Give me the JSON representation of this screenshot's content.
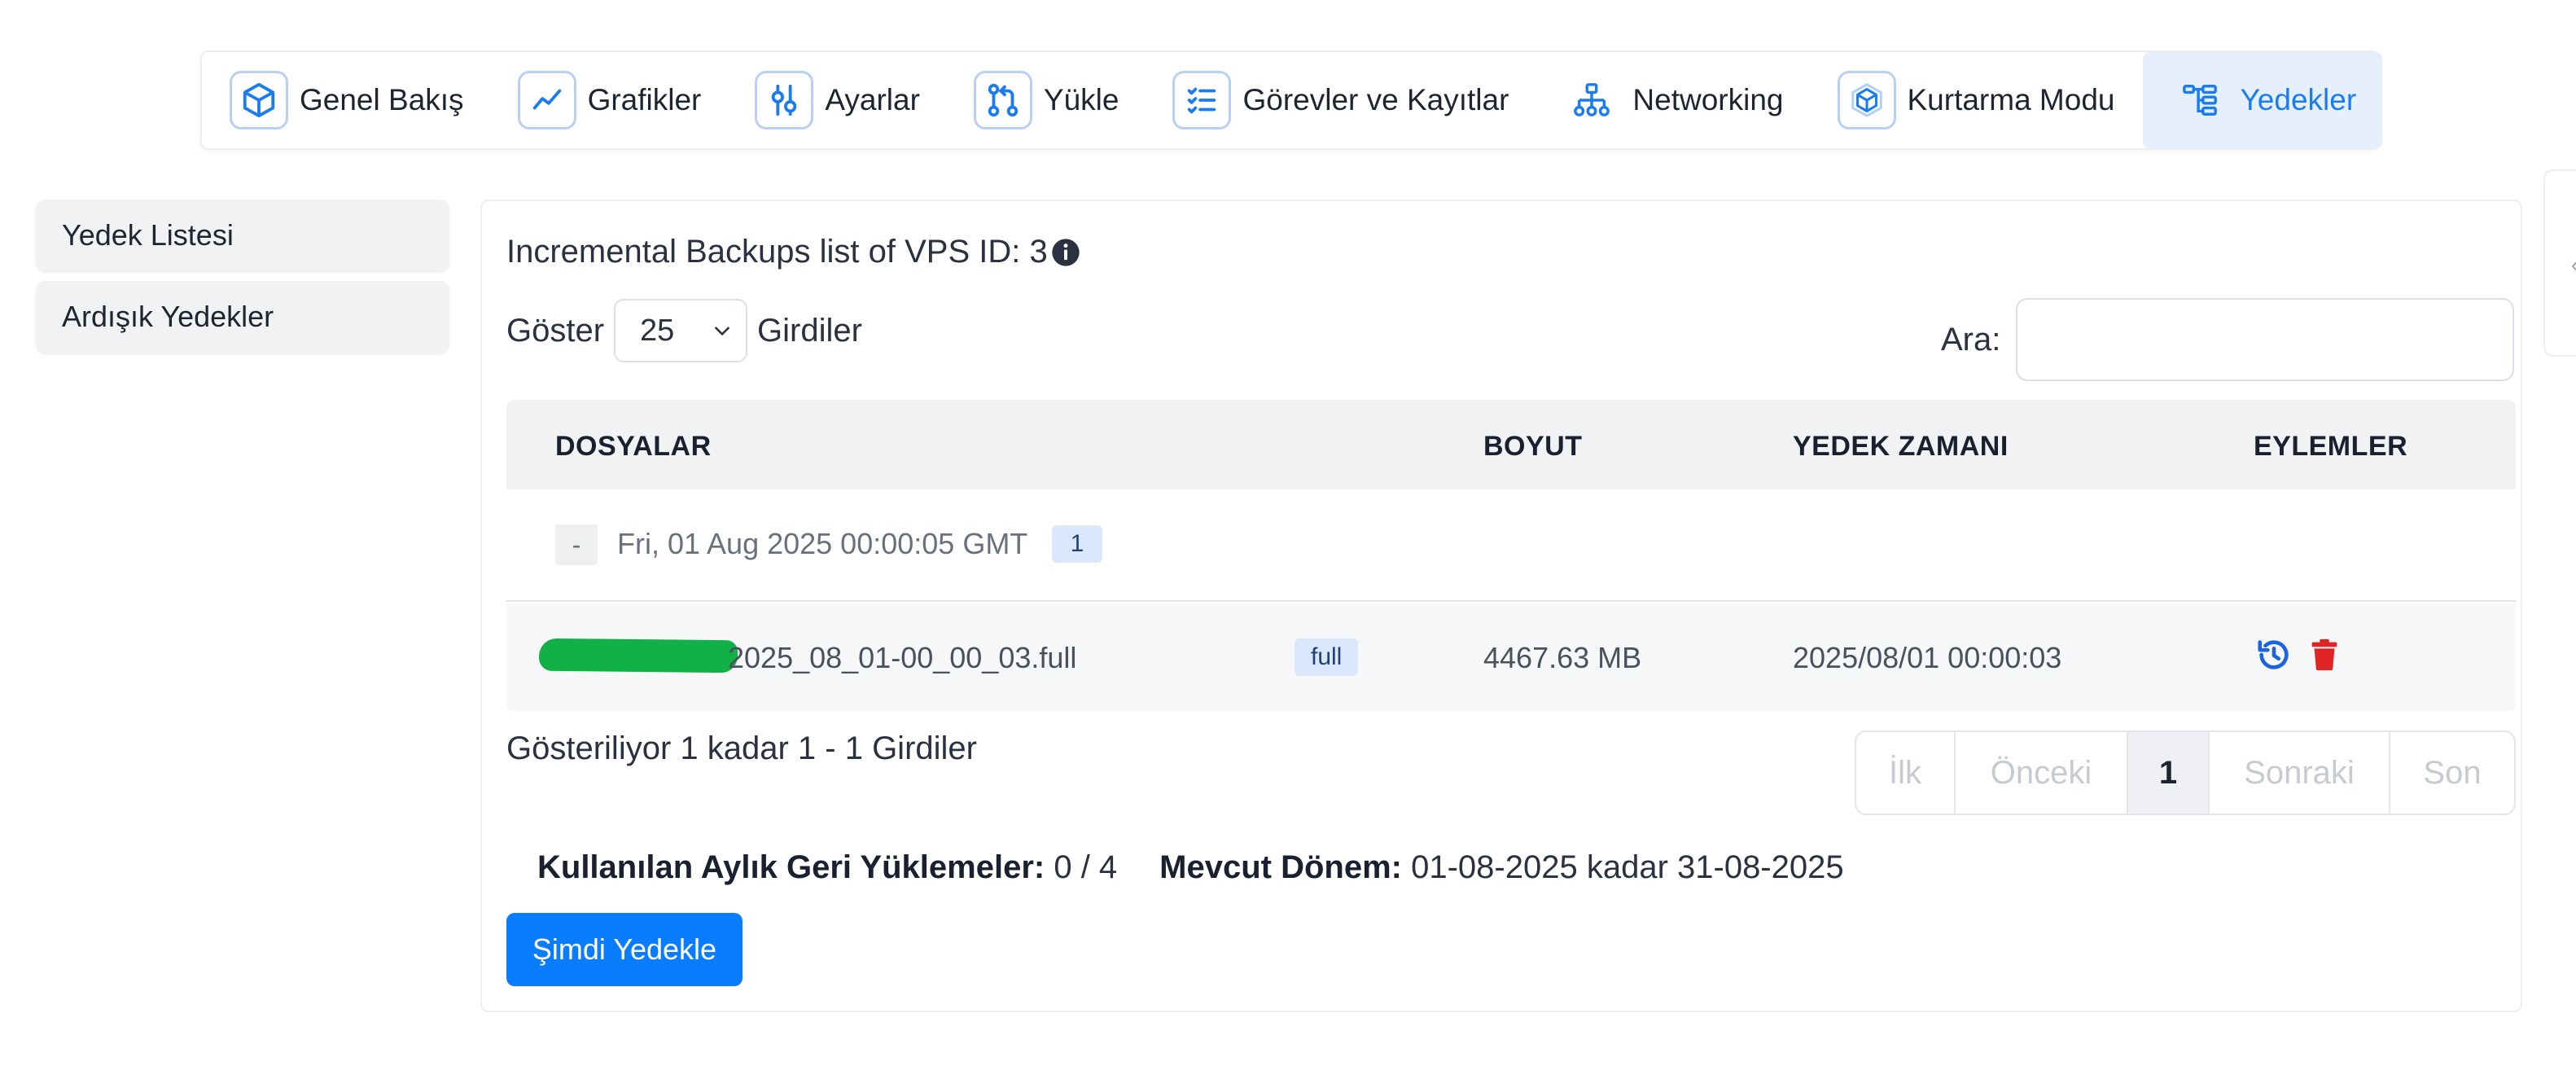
{
  "topnav": {
    "tabs": [
      {
        "label": "Genel Bakış",
        "icon": "cube-icon"
      },
      {
        "label": "Grafikler",
        "icon": "chart-line-icon"
      },
      {
        "label": "Ayarlar",
        "icon": "sliders-icon"
      },
      {
        "label": "Yükle",
        "icon": "git-pull-icon"
      },
      {
        "label": "Görevler ve Kayıtlar",
        "icon": "checklist-icon"
      },
      {
        "label": "Networking",
        "icon": "network-icon"
      },
      {
        "label": "Kurtarma Modu",
        "icon": "rescue-cube-icon"
      },
      {
        "label": "Yedekler",
        "icon": "hierarchy-icon",
        "active": true
      }
    ]
  },
  "sidebar": {
    "items": [
      {
        "label": "Yedek Listesi"
      },
      {
        "label": "Ardışık Yedekler"
      }
    ]
  },
  "panel": {
    "title": "Incremental Backups list of VPS ID: 3",
    "length": {
      "prefix": "Göster",
      "value": "25",
      "suffix": "Girdiler"
    },
    "search": {
      "label": "Ara:",
      "value": ""
    },
    "table": {
      "headers": {
        "files": "DOSYALAR",
        "size": "BOYUT",
        "time": "YEDEK ZAMANI",
        "actions": "EYLEMLER"
      },
      "group": {
        "toggle": "-",
        "date": "Fri, 01 Aug 2025 00:00:05 GMT",
        "count": "1"
      },
      "rows": [
        {
          "file": "2025_08_01-00_00_03.full",
          "type": "full",
          "size": "4467.63 MB",
          "time": "2025/08/01 00:00:03"
        }
      ]
    },
    "info": "Gösteriliyor 1 kadar 1 - 1 Girdiler",
    "pagination": {
      "first": "İlk",
      "prev": "Önceki",
      "current": "1",
      "next": "Sonraki",
      "last": "Son"
    },
    "stats": {
      "restores_label": "Kullanılan Aylık Geri Yüklemeler:",
      "restores_value": "0 / 4",
      "period_label": "Mevcut Dönem:",
      "period_value": "01-08-2025 kadar 31-08-2025"
    },
    "backup_button": "Şimdi Yedekle"
  },
  "colors": {
    "accent": "#0a7cff",
    "active_tab_bg": "#e6f0fd",
    "delete": "#e02424",
    "redaction": "#12b148"
  }
}
